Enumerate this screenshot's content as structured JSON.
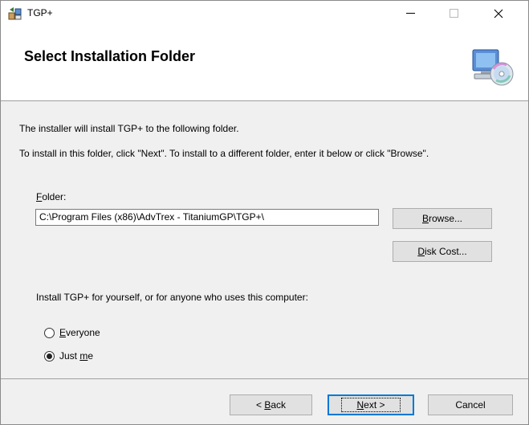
{
  "window": {
    "title": "TGP+"
  },
  "banner": {
    "title": "Select Installation Folder",
    "icon": "computer-cd-icon"
  },
  "body": {
    "line1": "The installer will install TGP+ to the following folder.",
    "line2": "To install in this folder, click \"Next\". To install to a different folder, enter it below or click \"Browse\"."
  },
  "folder": {
    "label_accel": "F",
    "label_rest": "older:",
    "value": "C:\\Program Files (x86)\\AdvTrex - TitaniumGP\\TGP+\\"
  },
  "buttons": {
    "browse_accel": "B",
    "browse_rest": "rowse...",
    "disk_cost_accel": "D",
    "disk_cost_rest": "isk Cost...",
    "back_prefix": "< ",
    "back_accel": "B",
    "back_rest": "ack",
    "next_accel": "N",
    "next_rest": "ext >",
    "cancel": "Cancel"
  },
  "install_for": {
    "prompt": "Install TGP+ for yourself, or for anyone who uses this computer:",
    "options": [
      {
        "accel": "E",
        "rest": "veryone",
        "selected": false
      },
      {
        "prefix": "Just ",
        "accel": "m",
        "rest": "e",
        "selected": true
      }
    ]
  },
  "colors": {
    "focus_border": "#0078d7",
    "dialog_bg": "#f0f0f0",
    "banner_bg": "#ffffff"
  }
}
